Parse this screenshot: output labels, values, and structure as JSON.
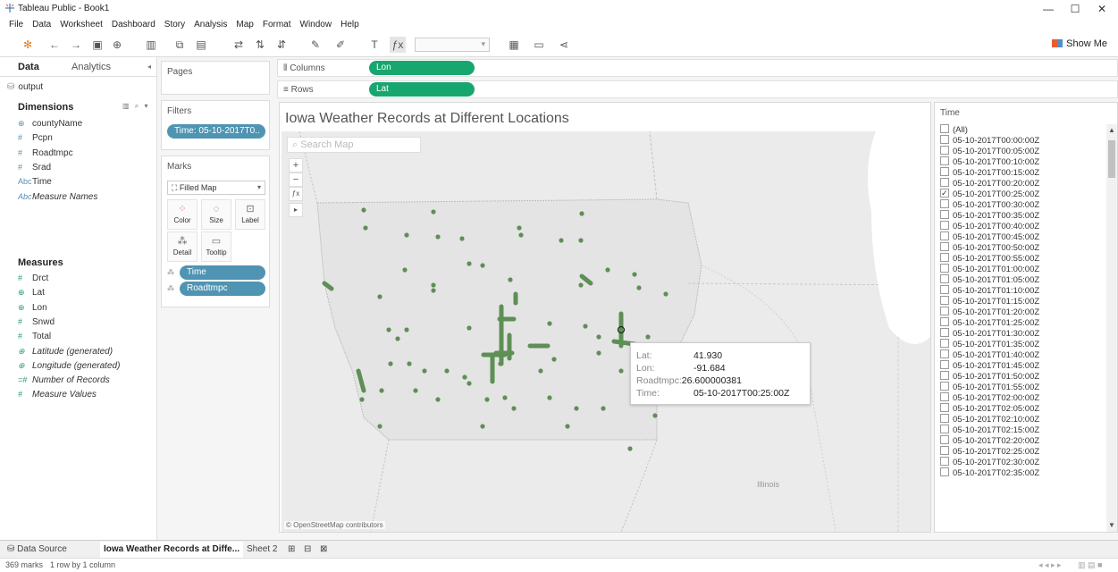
{
  "window": {
    "title": "Tableau Public - Book1"
  },
  "menu": [
    "File",
    "Data",
    "Worksheet",
    "Dashboard",
    "Story",
    "Analysis",
    "Map",
    "Format",
    "Window",
    "Help"
  ],
  "toolbar": {
    "show_me": "Show Me"
  },
  "data_pane": {
    "tab_data": "Data",
    "tab_analytics": "Analytics",
    "source": "output",
    "dimensions_header": "Dimensions",
    "dimensions": [
      {
        "icon": "⊕",
        "name": "countyName",
        "italic": false
      },
      {
        "icon": "#",
        "name": "Pcpn",
        "italic": false
      },
      {
        "icon": "#",
        "name": "Roadtmpc",
        "italic": false
      },
      {
        "icon": "#",
        "name": "Srad",
        "italic": false
      },
      {
        "icon": "Abc",
        "name": "Time",
        "italic": false
      },
      {
        "icon": "Abc",
        "name": "Measure Names",
        "italic": true
      }
    ],
    "measures_header": "Measures",
    "measures": [
      {
        "icon": "#",
        "name": "Drct",
        "italic": false
      },
      {
        "icon": "⊕",
        "name": "Lat",
        "italic": false
      },
      {
        "icon": "⊕",
        "name": "Lon",
        "italic": false
      },
      {
        "icon": "#",
        "name": "Snwd",
        "italic": false
      },
      {
        "icon": "#",
        "name": "Total",
        "italic": false
      },
      {
        "icon": "⊕",
        "name": "Latitude (generated)",
        "italic": true
      },
      {
        "icon": "⊕",
        "name": "Longitude (generated)",
        "italic": true
      },
      {
        "icon": "=#",
        "name": "Number of Records",
        "italic": true
      },
      {
        "icon": "#",
        "name": "Measure Values",
        "italic": true
      }
    ]
  },
  "cards": {
    "pages": "Pages",
    "filters": "Filters",
    "filter_pill": "Time: 05-10-2017T0..",
    "marks": "Marks",
    "marks_type": "Filled Map",
    "mark_buttons": [
      "Color",
      "Size",
      "Label",
      "Detail",
      "Tooltip"
    ],
    "marks_pills": [
      "Time",
      "Roadtmpc"
    ]
  },
  "shelves": {
    "columns_label": "Columns",
    "columns_pill": "Lon",
    "rows_label": "Rows",
    "rows_pill": "Lat"
  },
  "view": {
    "title": "Iowa Weather Records at Different Locations",
    "search_placeholder": "Search Map",
    "credit": "© OpenStreetMap contributors",
    "state_label": "Illinois"
  },
  "tooltip": {
    "lat_label": "Lat:",
    "lat": "41.930",
    "lon_label": "Lon:",
    "lon": "-91.684",
    "roadtmpc_label": "Roadtmpc:",
    "roadtmpc": "26.600000381",
    "time_label": "Time:",
    "time": "05-10-2017T00:25:00Z"
  },
  "filter_card": {
    "title": "Time",
    "items": [
      {
        "label": "(All)",
        "checked": false
      },
      {
        "label": "05-10-2017T00:00:00Z",
        "checked": false
      },
      {
        "label": "05-10-2017T00:05:00Z",
        "checked": false
      },
      {
        "label": "05-10-2017T00:10:00Z",
        "checked": false
      },
      {
        "label": "05-10-2017T00:15:00Z",
        "checked": false
      },
      {
        "label": "05-10-2017T00:20:00Z",
        "checked": false
      },
      {
        "label": "05-10-2017T00:25:00Z",
        "checked": true
      },
      {
        "label": "05-10-2017T00:30:00Z",
        "checked": false
      },
      {
        "label": "05-10-2017T00:35:00Z",
        "checked": false
      },
      {
        "label": "05-10-2017T00:40:00Z",
        "checked": false
      },
      {
        "label": "05-10-2017T00:45:00Z",
        "checked": false
      },
      {
        "label": "05-10-2017T00:50:00Z",
        "checked": false
      },
      {
        "label": "05-10-2017T00:55:00Z",
        "checked": false
      },
      {
        "label": "05-10-2017T01:00:00Z",
        "checked": false
      },
      {
        "label": "05-10-2017T01:05:00Z",
        "checked": false
      },
      {
        "label": "05-10-2017T01:10:00Z",
        "checked": false
      },
      {
        "label": "05-10-2017T01:15:00Z",
        "checked": false
      },
      {
        "label": "05-10-2017T01:20:00Z",
        "checked": false
      },
      {
        "label": "05-10-2017T01:25:00Z",
        "checked": false
      },
      {
        "label": "05-10-2017T01:30:00Z",
        "checked": false
      },
      {
        "label": "05-10-2017T01:35:00Z",
        "checked": false
      },
      {
        "label": "05-10-2017T01:40:00Z",
        "checked": false
      },
      {
        "label": "05-10-2017T01:45:00Z",
        "checked": false
      },
      {
        "label": "05-10-2017T01:50:00Z",
        "checked": false
      },
      {
        "label": "05-10-2017T01:55:00Z",
        "checked": false
      },
      {
        "label": "05-10-2017T02:00:00Z",
        "checked": false
      },
      {
        "label": "05-10-2017T02:05:00Z",
        "checked": false
      },
      {
        "label": "05-10-2017T02:10:00Z",
        "checked": false
      },
      {
        "label": "05-10-2017T02:15:00Z",
        "checked": false
      },
      {
        "label": "05-10-2017T02:20:00Z",
        "checked": false
      },
      {
        "label": "05-10-2017T02:25:00Z",
        "checked": false
      },
      {
        "label": "05-10-2017T02:30:00Z",
        "checked": false
      },
      {
        "label": "05-10-2017T02:35:00Z",
        "checked": false
      }
    ]
  },
  "sheet_tabs": {
    "data_source": "Data Source",
    "active_sheet": "Iowa Weather Records at Diffe...",
    "sheet2": "Sheet 2"
  },
  "status": {
    "marks": "369 marks",
    "layout": "1 row by 1 column"
  },
  "colors": {
    "accent_green": "#18a66f",
    "pill_blue": "#4f94b3",
    "mark_green": "#5e8f55"
  }
}
